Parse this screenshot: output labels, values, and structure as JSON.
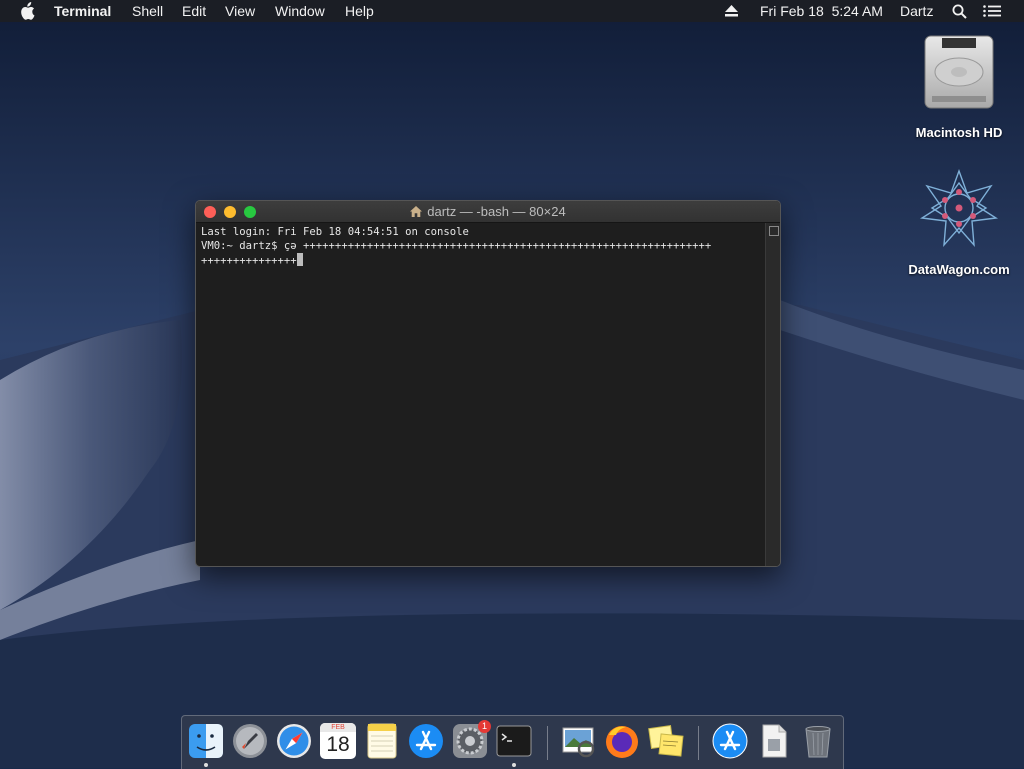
{
  "menubar": {
    "app_name": "Terminal",
    "items": [
      "Shell",
      "Edit",
      "View",
      "Window",
      "Help"
    ],
    "clock": "Fri Feb 18  5:24 AM",
    "user": "Dartz"
  },
  "desktop": {
    "icons": [
      {
        "label": "Macintosh HD",
        "icon": "hard-drive-icon"
      },
      {
        "label": "DataWagon.com",
        "icon": "datawagon-logo-icon"
      }
    ]
  },
  "terminal": {
    "title": "dartz — -bash — 80×24",
    "lines": [
      "Last login: Fri Feb 18 04:54:51 on console",
      "VM0:~ dartz$ çə ++++++++++++++++++++++++++++++++++++++++++++++++++++++++++++++++",
      "+++++++++++++++"
    ]
  },
  "dock": {
    "calendar_month": "FEB",
    "calendar_day": "18",
    "badge_count": "1",
    "apps": [
      "Finder",
      "Launchpad",
      "Safari",
      "Calendar",
      "Notes",
      "App Store",
      "System Preferences",
      "Terminal",
      "Preview",
      "Firefox",
      "Stickies",
      "App Store Downloads",
      "Document",
      "Trash"
    ]
  },
  "colors": {
    "close": "#fe5f57",
    "minimize": "#febc2e",
    "zoom": "#28c840",
    "terminal_bg": "#1e1e1e"
  }
}
